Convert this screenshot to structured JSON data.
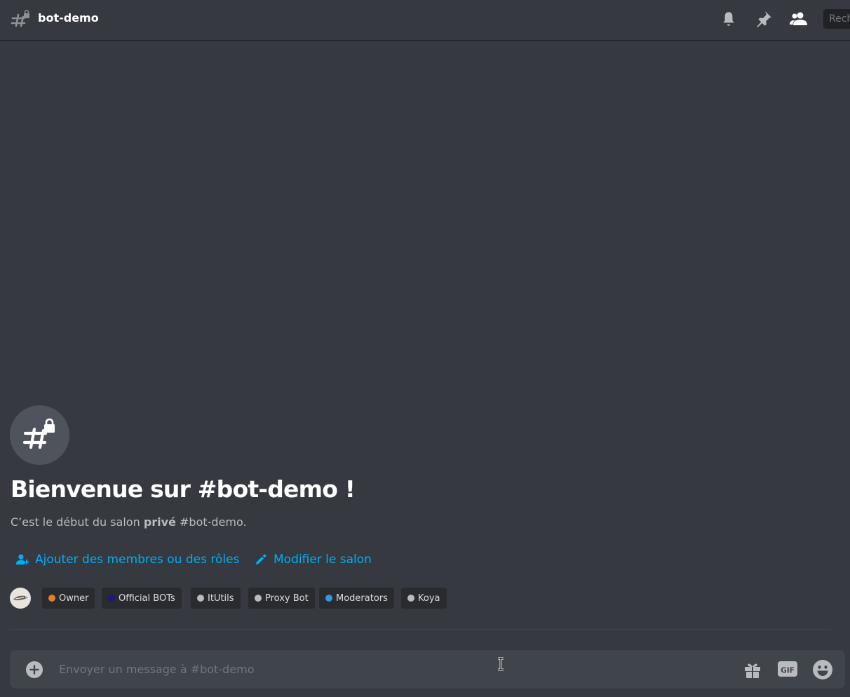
{
  "header": {
    "channel_name": "bot-demo",
    "search_placeholder": "Rechercher"
  },
  "welcome": {
    "title": "Bienvenue sur #bot-demo !",
    "subtitle_prefix": "C’est le début du salon ",
    "subtitle_bold": "privé",
    "subtitle_suffix": " #bot-demo.",
    "add_members_label": "Ajouter des membres ou des rôles",
    "edit_channel_label": "Modifier le salon"
  },
  "roles": [
    {
      "name": "Owner",
      "color": "#e67e22"
    },
    {
      "name": "Official BOTs",
      "color": "#1a1a7a"
    },
    {
      "name": "ItUtils",
      "color": "#b9bbbe"
    },
    {
      "name": "Proxy Bot",
      "color": "#b9bbbe"
    },
    {
      "name": "Moderators",
      "color": "#3498db"
    },
    {
      "name": "Koya",
      "color": "#b9bbbe"
    }
  ],
  "composer": {
    "placeholder": "Envoyer un message à #bot-demo",
    "gif_label": "GIF"
  },
  "colors": {
    "background": "#36393f",
    "link": "#00aff4",
    "composer_bg": "#40444b",
    "header_icon": "#b9bbbe"
  },
  "icons": [
    "hash-lock-icon",
    "bell-icon",
    "pin-icon",
    "members-icon",
    "add-member-icon",
    "pencil-icon",
    "plus-circle-icon",
    "gift-icon",
    "gif-icon",
    "emoji-icon"
  ]
}
